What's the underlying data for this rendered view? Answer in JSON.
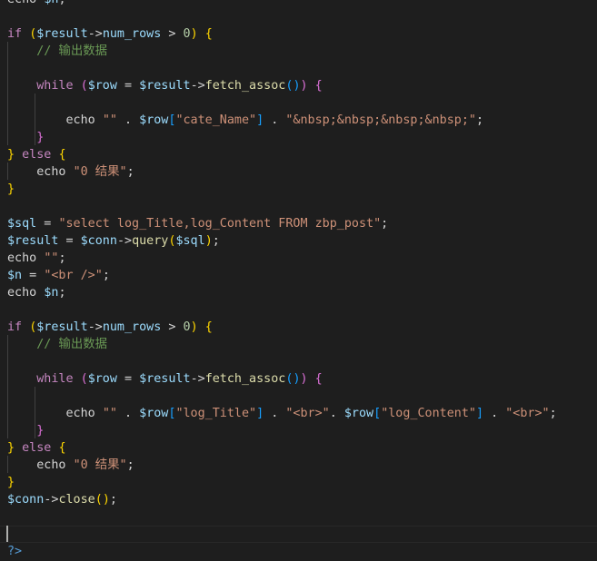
{
  "editor": {
    "lines": [
      [
        {
          "t": "echo ",
          "c": "echo-kw"
        },
        {
          "t": "$n",
          "c": "var"
        },
        {
          "t": ";",
          "c": "op"
        }
      ],
      [],
      [
        {
          "t": "if ",
          "c": "kw"
        },
        {
          "t": "(",
          "c": "b1"
        },
        {
          "t": "$result",
          "c": "var"
        },
        {
          "t": "->",
          "c": "op"
        },
        {
          "t": "num_rows",
          "c": "var"
        },
        {
          "t": " > ",
          "c": "op"
        },
        {
          "t": "0",
          "c": "num"
        },
        {
          "t": ")",
          "c": "b1"
        },
        {
          "t": " ",
          "c": "op"
        },
        {
          "t": "{",
          "c": "b1"
        }
      ],
      [
        {
          "t": "    ",
          "c": "op"
        },
        {
          "t": "// 输出数据",
          "c": "cmt"
        }
      ],
      [],
      [
        {
          "t": "    ",
          "c": "op"
        },
        {
          "t": "while ",
          "c": "kw"
        },
        {
          "t": "(",
          "c": "b2"
        },
        {
          "t": "$row",
          "c": "var"
        },
        {
          "t": " = ",
          "c": "op"
        },
        {
          "t": "$result",
          "c": "var"
        },
        {
          "t": "->",
          "c": "op"
        },
        {
          "t": "fetch_assoc",
          "c": "fn"
        },
        {
          "t": "(",
          "c": "b3"
        },
        {
          "t": ")",
          "c": "b3"
        },
        {
          "t": ")",
          "c": "b2"
        },
        {
          "t": " ",
          "c": "op"
        },
        {
          "t": "{",
          "c": "b2"
        }
      ],
      [],
      [
        {
          "t": "        ",
          "c": "op"
        },
        {
          "t": "echo ",
          "c": "echo-kw"
        },
        {
          "t": "\"\"",
          "c": "str"
        },
        {
          "t": " . ",
          "c": "op"
        },
        {
          "t": "$row",
          "c": "var"
        },
        {
          "t": "[",
          "c": "b3"
        },
        {
          "t": "\"cate_Name\"",
          "c": "str"
        },
        {
          "t": "]",
          "c": "b3"
        },
        {
          "t": " . ",
          "c": "op"
        },
        {
          "t": "\"&nbsp;&nbsp;&nbsp;&nbsp;\"",
          "c": "str"
        },
        {
          "t": ";",
          "c": "op"
        }
      ],
      [
        {
          "t": "    ",
          "c": "op"
        },
        {
          "t": "}",
          "c": "b2"
        }
      ],
      [
        {
          "t": "}",
          "c": "b1"
        },
        {
          "t": " else ",
          "c": "kw"
        },
        {
          "t": "{",
          "c": "b1"
        }
      ],
      [
        {
          "t": "    ",
          "c": "op"
        },
        {
          "t": "echo ",
          "c": "echo-kw"
        },
        {
          "t": "\"0 结果\"",
          "c": "str"
        },
        {
          "t": ";",
          "c": "op"
        }
      ],
      [
        {
          "t": "}",
          "c": "b1"
        }
      ],
      [],
      [
        {
          "t": "$sql",
          "c": "var"
        },
        {
          "t": " = ",
          "c": "op"
        },
        {
          "t": "\"select log_Title,log_Content FROM zbp_post\"",
          "c": "str"
        },
        {
          "t": ";",
          "c": "op"
        }
      ],
      [
        {
          "t": "$result",
          "c": "var"
        },
        {
          "t": " = ",
          "c": "op"
        },
        {
          "t": "$conn",
          "c": "var"
        },
        {
          "t": "->",
          "c": "op"
        },
        {
          "t": "query",
          "c": "fn"
        },
        {
          "t": "(",
          "c": "b1"
        },
        {
          "t": "$sql",
          "c": "var"
        },
        {
          "t": ")",
          "c": "b1"
        },
        {
          "t": ";",
          "c": "op"
        }
      ],
      [
        {
          "t": "echo ",
          "c": "echo-kw"
        },
        {
          "t": "\"\"",
          "c": "str"
        },
        {
          "t": ";",
          "c": "op"
        }
      ],
      [
        {
          "t": "$n",
          "c": "var"
        },
        {
          "t": " = ",
          "c": "op"
        },
        {
          "t": "\"<br />\"",
          "c": "str"
        },
        {
          "t": ";",
          "c": "op"
        }
      ],
      [
        {
          "t": "echo ",
          "c": "echo-kw"
        },
        {
          "t": "$n",
          "c": "var"
        },
        {
          "t": ";",
          "c": "op"
        }
      ],
      [],
      [
        {
          "t": "if ",
          "c": "kw"
        },
        {
          "t": "(",
          "c": "b1"
        },
        {
          "t": "$result",
          "c": "var"
        },
        {
          "t": "->",
          "c": "op"
        },
        {
          "t": "num_rows",
          "c": "var"
        },
        {
          "t": " > ",
          "c": "op"
        },
        {
          "t": "0",
          "c": "num"
        },
        {
          "t": ")",
          "c": "b1"
        },
        {
          "t": " ",
          "c": "op"
        },
        {
          "t": "{",
          "c": "b1"
        }
      ],
      [
        {
          "t": "    ",
          "c": "op"
        },
        {
          "t": "// 输出数据",
          "c": "cmt"
        }
      ],
      [],
      [
        {
          "t": "    ",
          "c": "op"
        },
        {
          "t": "while ",
          "c": "kw"
        },
        {
          "t": "(",
          "c": "b2"
        },
        {
          "t": "$row",
          "c": "var"
        },
        {
          "t": " = ",
          "c": "op"
        },
        {
          "t": "$result",
          "c": "var"
        },
        {
          "t": "->",
          "c": "op"
        },
        {
          "t": "fetch_assoc",
          "c": "fn"
        },
        {
          "t": "(",
          "c": "b3"
        },
        {
          "t": ")",
          "c": "b3"
        },
        {
          "t": ")",
          "c": "b2"
        },
        {
          "t": " ",
          "c": "op"
        },
        {
          "t": "{",
          "c": "b2"
        }
      ],
      [],
      [
        {
          "t": "        ",
          "c": "op"
        },
        {
          "t": "echo ",
          "c": "echo-kw"
        },
        {
          "t": "\"\"",
          "c": "str"
        },
        {
          "t": " . ",
          "c": "op"
        },
        {
          "t": "$row",
          "c": "var"
        },
        {
          "t": "[",
          "c": "b3"
        },
        {
          "t": "\"log_Title\"",
          "c": "str"
        },
        {
          "t": "]",
          "c": "b3"
        },
        {
          "t": " . ",
          "c": "op"
        },
        {
          "t": "\"<br>\"",
          "c": "str"
        },
        {
          "t": ". ",
          "c": "op"
        },
        {
          "t": "$row",
          "c": "var"
        },
        {
          "t": "[",
          "c": "b3"
        },
        {
          "t": "\"log_Content\"",
          "c": "str"
        },
        {
          "t": "]",
          "c": "b3"
        },
        {
          "t": " . ",
          "c": "op"
        },
        {
          "t": "\"<br>\"",
          "c": "str"
        },
        {
          "t": ";",
          "c": "op"
        }
      ],
      [
        {
          "t": "    ",
          "c": "op"
        },
        {
          "t": "}",
          "c": "b2"
        }
      ],
      [
        {
          "t": "}",
          "c": "b1"
        },
        {
          "t": " else ",
          "c": "kw"
        },
        {
          "t": "{",
          "c": "b1"
        }
      ],
      [
        {
          "t": "    ",
          "c": "op"
        },
        {
          "t": "echo ",
          "c": "echo-kw"
        },
        {
          "t": "\"0 结果\"",
          "c": "str"
        },
        {
          "t": ";",
          "c": "op"
        }
      ],
      [
        {
          "t": "}",
          "c": "b1"
        }
      ],
      [
        {
          "t": "$conn",
          "c": "var"
        },
        {
          "t": "->",
          "c": "op"
        },
        {
          "t": "close",
          "c": "fn"
        },
        {
          "t": "(",
          "c": "b1"
        },
        {
          "t": ")",
          "c": "b1"
        },
        {
          "t": ";",
          "c": "op"
        }
      ],
      [],
      [],
      [
        {
          "t": "?>",
          "c": "php-tag"
        }
      ]
    ],
    "cursor_line": 31
  },
  "colors": {
    "background": "#1e1e1e",
    "keyword": "#c586c0",
    "variable": "#9cdcfe",
    "function": "#dcdcaa",
    "string": "#ce9178",
    "number": "#b5cea8",
    "comment": "#6a9955",
    "bracket_level_1": "#ffd700",
    "bracket_level_2": "#da70d6",
    "bracket_level_3": "#179fff",
    "php_tag": "#569cd6"
  }
}
